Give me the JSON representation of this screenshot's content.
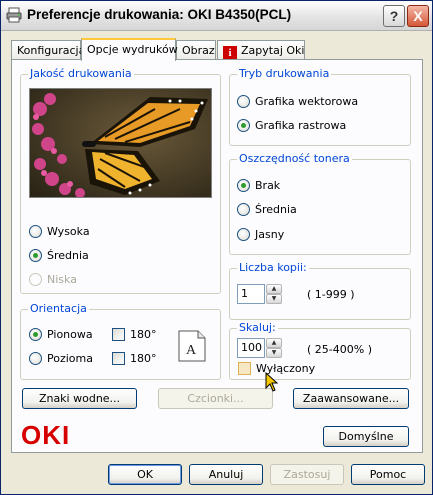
{
  "window": {
    "title": "Preferencje drukowania: OKI B4350(PCL)"
  },
  "title_buttons": {
    "help": "?",
    "close": "X"
  },
  "tabs": [
    {
      "label": "Konfiguracja"
    },
    {
      "label": "Opcje wydruków"
    },
    {
      "label": "Obraz"
    },
    {
      "label": "Zapytaj Oki"
    }
  ],
  "quality": {
    "title": "Jakość drukowania",
    "options": [
      {
        "label": "Wysoka",
        "checked": false,
        "enabled": true
      },
      {
        "label": "Średnia",
        "checked": true,
        "enabled": true
      },
      {
        "label": "Niska",
        "checked": false,
        "enabled": false
      }
    ]
  },
  "print_mode": {
    "title": "Tryb drukowania",
    "options": [
      {
        "label": "Grafika wektorowa",
        "checked": false
      },
      {
        "label": "Grafika rastrowa",
        "checked": true
      }
    ]
  },
  "toner_saving": {
    "title": "Oszczędność tonera",
    "options": [
      {
        "label": "Brak",
        "checked": true
      },
      {
        "label": "Średnia",
        "checked": false
      },
      {
        "label": "Jasny",
        "checked": false
      }
    ]
  },
  "copies": {
    "title": "Liczba kopii:",
    "value": "1",
    "range": "( 1-999 )"
  },
  "orientation": {
    "title": "Orientacja",
    "portrait": "Pionowa",
    "landscape": "Pozioma",
    "rotate_label": "180°"
  },
  "scale": {
    "title": "Skaluj:",
    "value": "100",
    "range": "( 25-400% )",
    "off_label": "Wyłączony"
  },
  "buttons": {
    "watermarks": "Znaki wodne...",
    "fonts": "Czcionki...",
    "advanced": "Zaawansowane...",
    "defaults": "Domyślne",
    "ok": "OK",
    "cancel": "Anuluj",
    "apply": "Zastosuj",
    "help": "Pomoc"
  },
  "logo": {
    "text": "OKI",
    "color": "#d60000"
  },
  "colors": {
    "group_title": "#0046d5",
    "radio_dot": "#2e9b2e",
    "tab_highlight": "#ffc83c"
  }
}
